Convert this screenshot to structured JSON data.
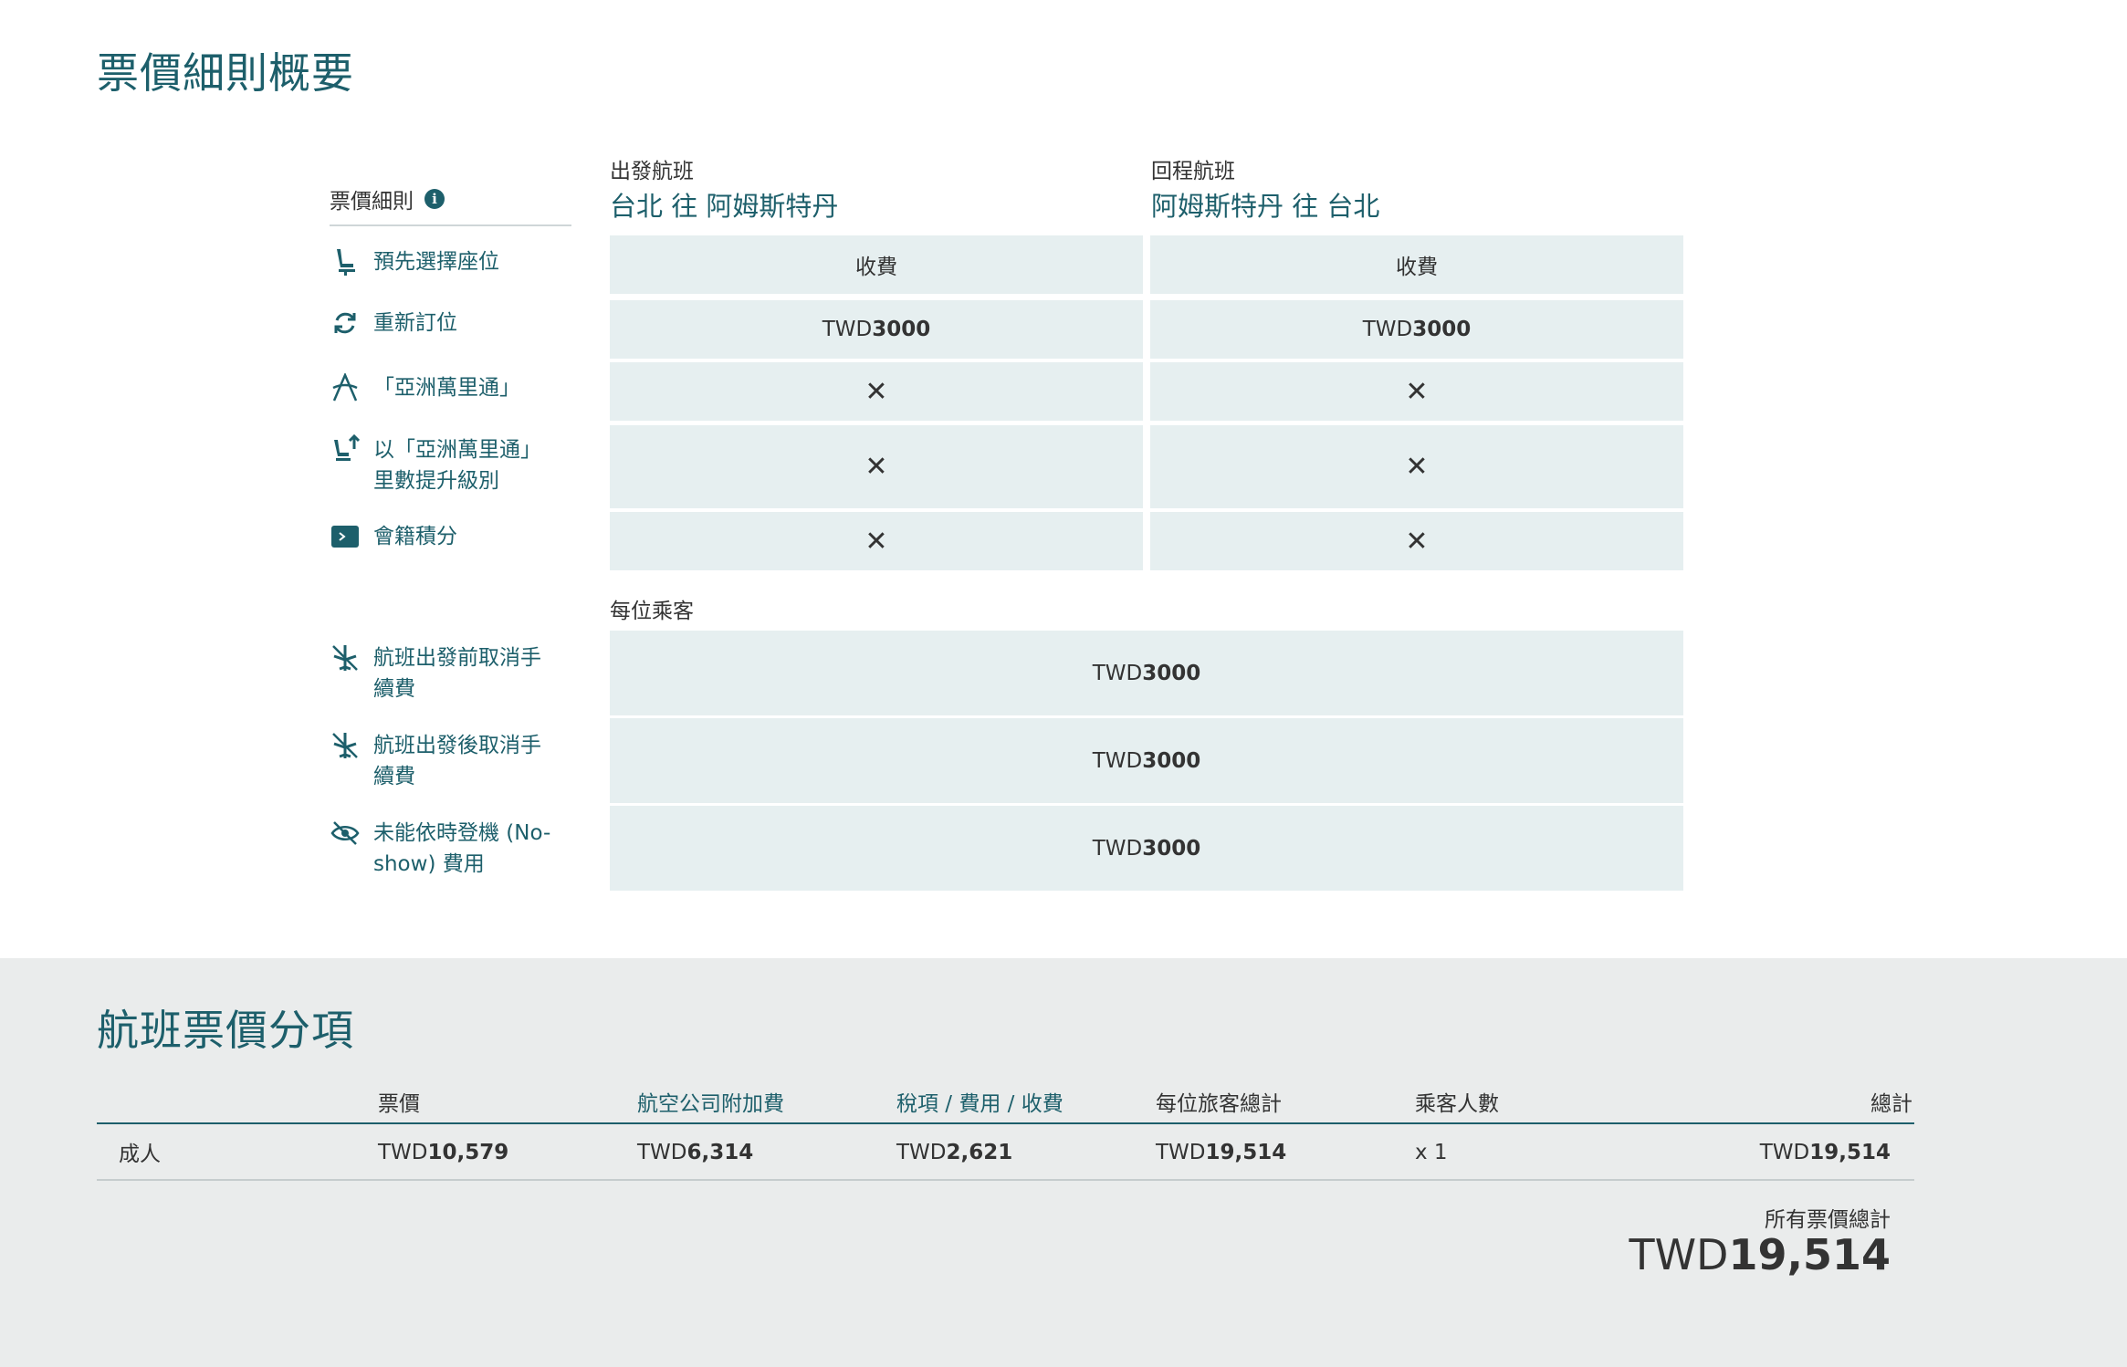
{
  "summary": {
    "title": "票價細則概要",
    "rules_label": "票價細則",
    "rules": [
      {
        "icon": "seat-icon",
        "label": "預先選擇座位"
      },
      {
        "icon": "rebook-icon",
        "label": "重新訂位"
      },
      {
        "icon": "asia-miles-icon",
        "label": "「亞洲萬里通」"
      },
      {
        "icon": "upgrade-seat-icon",
        "label": "以「亞洲萬里通」里數提升級別"
      },
      {
        "icon": "club-points-icon",
        "label": "會籍積分"
      },
      {
        "icon": "cancel-flight-icon",
        "label": "航班出發前取消手續費"
      },
      {
        "icon": "cancel-flight-icon",
        "label": "航班出發後取消手續費"
      },
      {
        "icon": "no-show-icon",
        "label": "未能依時登機 (No-show) 費用"
      }
    ],
    "outbound": {
      "heading": "出發航班",
      "route": "台北 往 阿姆斯特丹",
      "cells": [
        {
          "text": "收費"
        },
        {
          "prefix": "TWD",
          "amount": "3000"
        },
        {
          "text": "✕"
        },
        {
          "text": "✕"
        },
        {
          "text": "✕"
        }
      ]
    },
    "inbound": {
      "heading": "回程航班",
      "route": "阿姆斯特丹 往 台北",
      "cells": [
        {
          "text": "收費"
        },
        {
          "prefix": "TWD",
          "amount": "3000"
        },
        {
          "text": "✕"
        },
        {
          "text": "✕"
        },
        {
          "text": "✕"
        }
      ]
    },
    "per_passenger_label": "每位乘客",
    "per_passenger": [
      {
        "prefix": "TWD",
        "amount": "3000"
      },
      {
        "prefix": "TWD",
        "amount": "3000"
      },
      {
        "prefix": "TWD",
        "amount": "3000"
      }
    ]
  },
  "breakdown": {
    "title": "航班票價分項",
    "columns": {
      "fare": "票價",
      "carrier_surcharge": "航空公司附加費",
      "taxes": "稅項 / 費用 / 收費",
      "per_traveller": "每位旅客總計",
      "passengers": "乘客人數",
      "total": "總計"
    },
    "row": {
      "type": "成人",
      "fare_prefix": "TWD",
      "fare": "10,579",
      "surcharge_prefix": "TWD",
      "surcharge": "6,314",
      "taxes_prefix": "TWD",
      "taxes": "2,621",
      "per_traveller_prefix": "TWD",
      "per_traveller": "19,514",
      "passengers": "x 1",
      "total_prefix": "TWD",
      "total": "19,514"
    },
    "grand_total_label": "所有票價總計",
    "grand_total_prefix": "TWD",
    "grand_total": "19,514"
  },
  "colors": {
    "accent": "#1d5f6b",
    "cell_bg": "#e6eff0",
    "section_bg": "#eaecec"
  }
}
